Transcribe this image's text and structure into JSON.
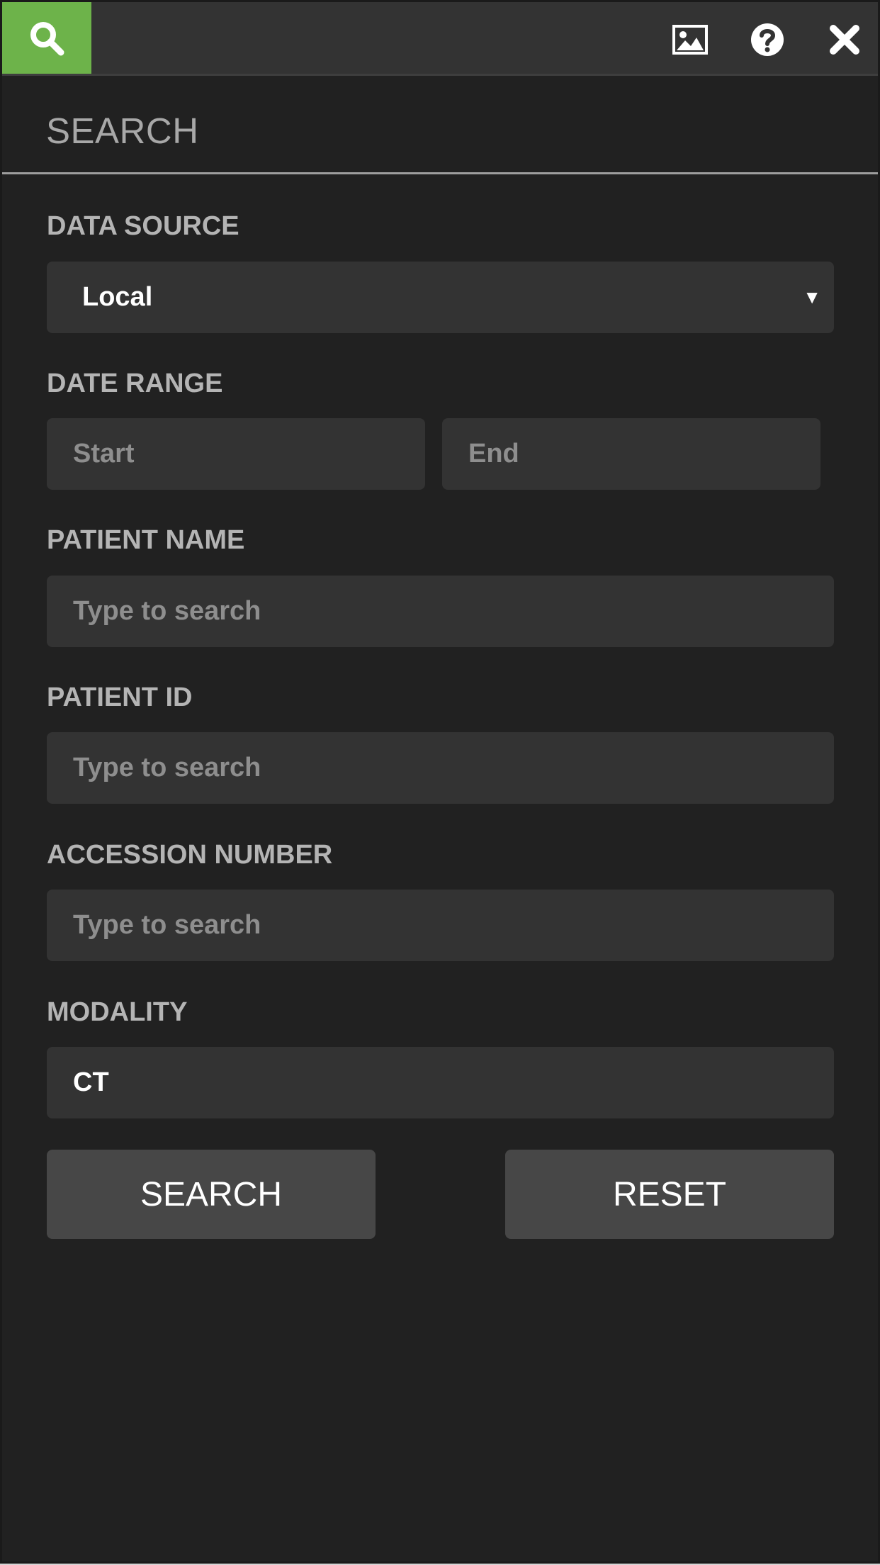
{
  "toolbar": {
    "tabs": [
      {
        "icon": "search-icon",
        "active": true
      }
    ],
    "actions": [
      {
        "icon": "image-icon"
      },
      {
        "icon": "help-icon"
      },
      {
        "icon": "close-icon"
      }
    ],
    "accent_color": "#6db34a"
  },
  "header": {
    "title": "SEARCH"
  },
  "form": {
    "data_source": {
      "label": "DATA SOURCE",
      "selected": "Local"
    },
    "date_range": {
      "label": "DATE RANGE",
      "start_placeholder": "Start",
      "end_placeholder": "End"
    },
    "patient_name": {
      "label": "PATIENT NAME",
      "placeholder": "Type to search"
    },
    "patient_id": {
      "label": "PATIENT ID",
      "placeholder": "Type to search"
    },
    "accession_number": {
      "label": "ACCESSION NUMBER",
      "placeholder": "Type to search"
    },
    "modality": {
      "label": "MODALITY",
      "value": "CT"
    }
  },
  "buttons": {
    "search_label": "SEARCH",
    "reset_label": "RESET"
  }
}
